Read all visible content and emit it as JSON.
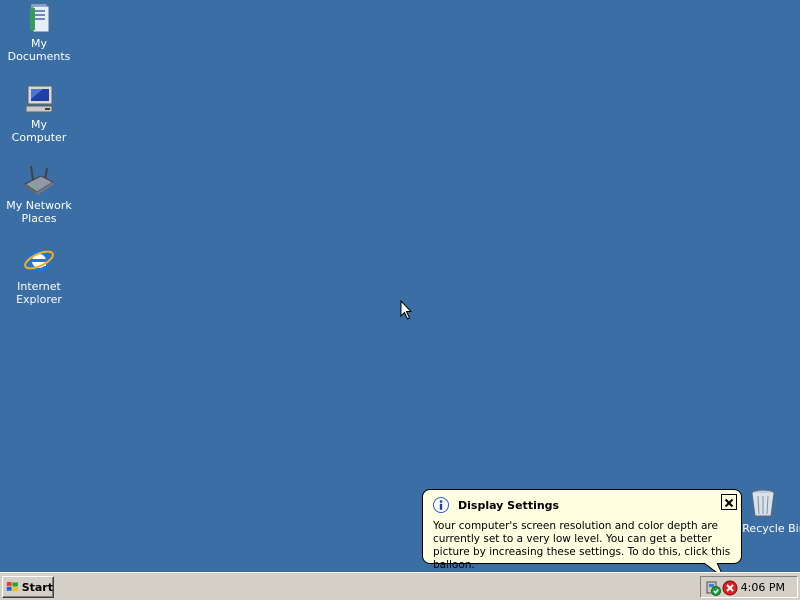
{
  "desktop": {
    "background_color": "#3a6ea5",
    "icons": [
      {
        "label": "My Documents",
        "icon": "my-documents-icon"
      },
      {
        "label": "My Computer",
        "icon": "my-computer-icon"
      },
      {
        "label": "My Network Places",
        "icon": "my-network-places-icon"
      },
      {
        "label": "Internet Explorer",
        "icon": "internet-explorer-icon"
      },
      {
        "label": "Recycle Bin",
        "icon": "recycle-bin-icon"
      }
    ]
  },
  "balloon": {
    "title": "Display Settings",
    "message": "Your computer's screen resolution and color depth are currently set to a very low level. You can get a better picture by increasing these settings. To do this, click this balloon.",
    "icon": "info-icon",
    "background_color": "#ffffe1"
  },
  "taskbar": {
    "start_label": "Start",
    "clock": "4:06 PM",
    "tray_icons": [
      "security-shield-icon",
      "display-error-icon"
    ]
  }
}
